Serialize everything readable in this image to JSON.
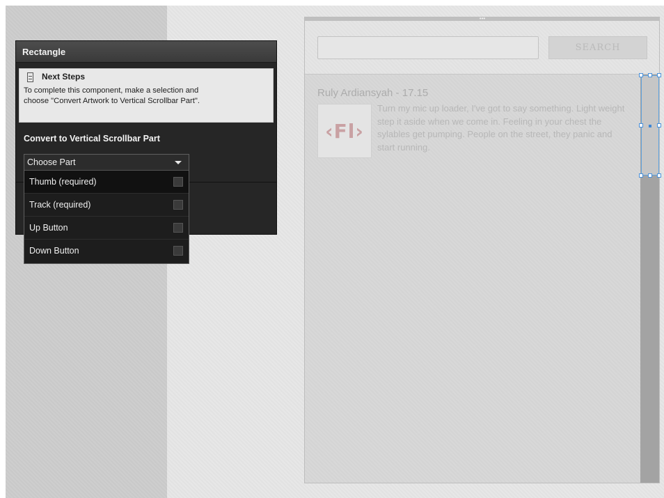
{
  "panel": {
    "title": "Rectangle",
    "next_steps": {
      "heading": "Next Steps",
      "line1": "To complete this component, make a selection and",
      "line2": "choose \"Convert Artwork to Vertical Scrollbar Part\"."
    },
    "convert_heading": "Convert to Vertical Scrollbar Part",
    "dropdown": {
      "selected": "Choose Part",
      "options": [
        {
          "label": "Thumb (required)"
        },
        {
          "label": "Track (required)"
        },
        {
          "label": "Up Button"
        },
        {
          "label": "Down Button"
        }
      ]
    }
  },
  "app": {
    "search_placeholder": "",
    "search_label": "SEARCH",
    "feed": [
      {
        "author": "Ruly Ardiansyah - 17.15",
        "logo": "‹Fl›",
        "text": "Turn my mic up loader, I've got to say something. Light weight step it aside when we come in. Feeling in your chest the sylables get pumping. People on the street, they panic and start running."
      }
    ]
  },
  "colors": {
    "panel_bg": "#262626",
    "selection": "#4a90d9",
    "logo": "#c9a1a3"
  }
}
